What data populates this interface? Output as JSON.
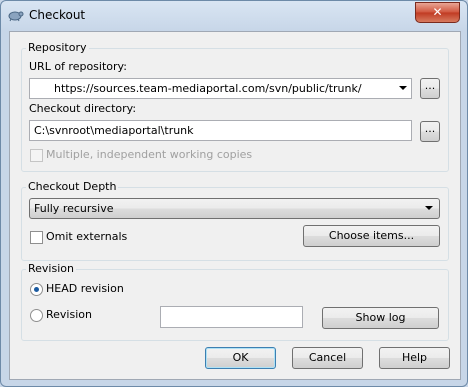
{
  "window": {
    "title": "Checkout",
    "close_glyph": "✕"
  },
  "repository": {
    "group_label": "Repository",
    "url_label": "URL of repository:",
    "url_value": "https://sources.team-mediaportal.com/svn/public/trunk/",
    "url_browse": "...",
    "dir_label": "Checkout directory:",
    "dir_value": "C:\\svnroot\\mediaportal\\trunk",
    "dir_browse": "...",
    "multiple_label": "Multiple, independent working copies"
  },
  "depth": {
    "group_label": "Checkout Depth",
    "selected": "Fully recursive",
    "omit_externals_label": "Omit externals",
    "choose_items_label": "Choose items..."
  },
  "revision": {
    "group_label": "Revision",
    "head_label": "HEAD revision",
    "revision_label": "Revision",
    "revision_value": "",
    "show_log_label": "Show log"
  },
  "buttons": {
    "ok": "OK",
    "cancel": "Cancel",
    "help": "Help"
  }
}
